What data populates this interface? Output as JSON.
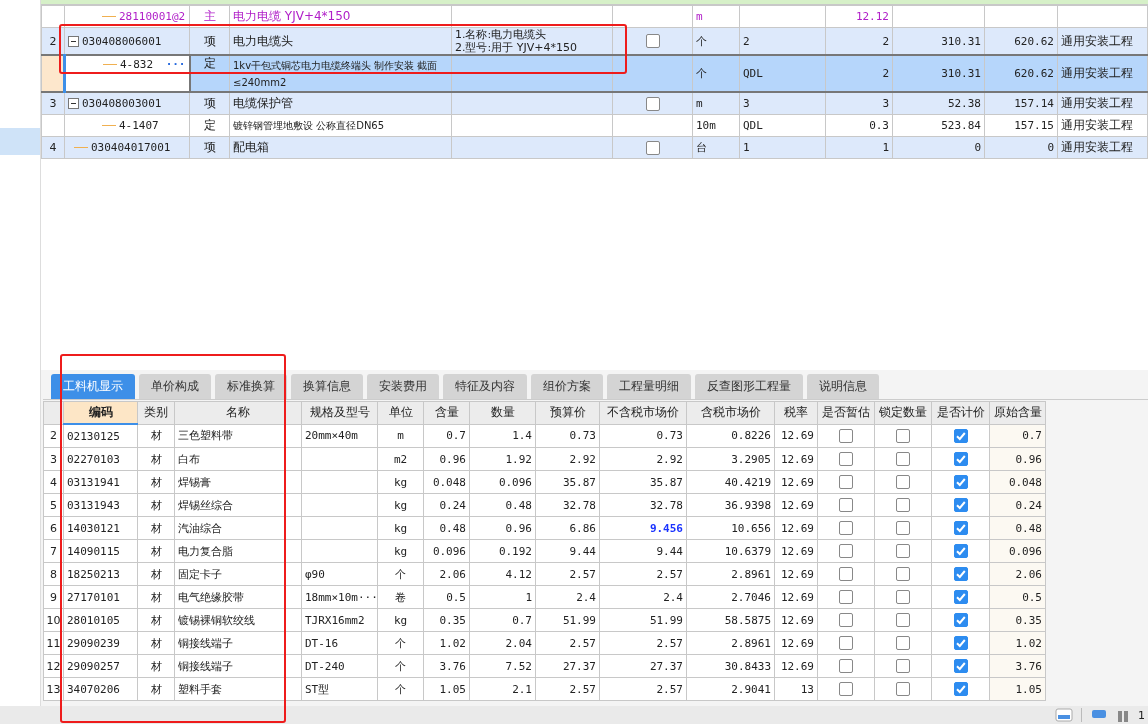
{
  "top_table": {
    "rows": [
      {
        "kind": "material",
        "selected": false,
        "code": "28110001@2",
        "type": "主",
        "name": "电力电缆 YJV+4*150",
        "unit": "m",
        "quantity": "12.12"
      },
      {
        "kind": "item",
        "selected": false,
        "num": "2",
        "expanded": true,
        "code": "030408006001",
        "type": "项",
        "name": "电力电缆头",
        "features": [
          "1.名称:电力电缆头",
          "2.型号:用于 YJV+4*150"
        ],
        "checked": false,
        "unit": "个",
        "qty_expr": "2",
        "quantity": "2",
        "price": "310.31",
        "total": "620.62",
        "category": "通用安装工程",
        "children": [
          {
            "kind": "quota",
            "selected": true,
            "code": "4-832",
            "edit_button": "···",
            "type": "定",
            "name": "1kv干包式铜芯电力电缆终端头 制作安装 截面≤240mm2",
            "unit": "个",
            "qty_expr": "QDL",
            "quantity": "2",
            "price": "310.31",
            "total": "620.62",
            "category": "通用安装工程"
          }
        ]
      },
      {
        "kind": "item",
        "selected": false,
        "num": "3",
        "expanded": true,
        "code": "030408003001",
        "type": "项",
        "name": "电缆保护管",
        "checked": false,
        "unit": "m",
        "qty_expr": "3",
        "quantity": "3",
        "price": "52.38",
        "total": "157.14",
        "category": "通用安装工程",
        "children": [
          {
            "kind": "quota",
            "selected": false,
            "code": "4-1407",
            "type": "定",
            "name": "镀锌钢管埋地敷设 公称直径DN65",
            "unit": "10m",
            "qty_expr": "QDL",
            "quantity": "0.3",
            "price": "523.84",
            "total": "157.15",
            "category": "通用安装工程"
          }
        ]
      },
      {
        "kind": "item",
        "selected": false,
        "num": "4",
        "code": "030404017001",
        "type": "项",
        "name": "配电箱",
        "checked": false,
        "unit": "台",
        "qty_expr": "1",
        "quantity": "1",
        "price": "0",
        "total": "0",
        "category": "通用安装工程"
      }
    ]
  },
  "tabs": [
    {
      "label": "工料机显示",
      "selected": true
    },
    {
      "label": "单价构成",
      "selected": false
    },
    {
      "label": "标准换算",
      "selected": false
    },
    {
      "label": "换算信息",
      "selected": false
    },
    {
      "label": "安装费用",
      "selected": false
    },
    {
      "label": "特征及内容",
      "selected": false
    },
    {
      "label": "组价方案",
      "selected": false
    },
    {
      "label": "工程量明细",
      "selected": false
    },
    {
      "label": "反查图形工程量",
      "selected": false
    },
    {
      "label": "说明信息",
      "selected": false
    }
  ],
  "resource_table": {
    "columns": [
      "编码",
      "类别",
      "名称",
      "规格及型号",
      "单位",
      "含量",
      "数量",
      "预算价",
      "不含税市场价",
      "含税市场价",
      "税率",
      "是否暂估",
      "锁定数量",
      "是否计价",
      "原始含量"
    ],
    "rows": [
      {
        "num": "2",
        "code": "02130125",
        "type": "材",
        "name": "三色塑料带",
        "spec": "20mm×40m",
        "unit": "m",
        "content": "0.7",
        "qty": "1.4",
        "budget": "0.73",
        "price_ex": "0.73",
        "modified": false,
        "price_in": "0.8226",
        "rate": "12.69",
        "estimated": false,
        "locked": false,
        "priced": true,
        "original": "0.7"
      },
      {
        "num": "3",
        "code": "02270103",
        "type": "材",
        "name": "白布",
        "unit": "m2",
        "content": "0.96",
        "qty": "1.92",
        "budget": "2.92",
        "price_ex": "2.92",
        "modified": false,
        "price_in": "3.2905",
        "rate": "12.69",
        "estimated": false,
        "locked": false,
        "priced": true,
        "original": "0.96"
      },
      {
        "num": "4",
        "code": "03131941",
        "type": "材",
        "name": "焊锡膏",
        "unit": "kg",
        "content": "0.048",
        "qty": "0.096",
        "budget": "35.87",
        "price_ex": "35.87",
        "modified": false,
        "price_in": "40.4219",
        "rate": "12.69",
        "estimated": false,
        "locked": false,
        "priced": true,
        "original": "0.048"
      },
      {
        "num": "5",
        "code": "03131943",
        "type": "材",
        "name": "焊锡丝综合",
        "unit": "kg",
        "content": "0.24",
        "qty": "0.48",
        "budget": "32.78",
        "price_ex": "32.78",
        "modified": false,
        "price_in": "36.9398",
        "rate": "12.69",
        "estimated": false,
        "locked": false,
        "priced": true,
        "original": "0.24"
      },
      {
        "num": "6",
        "code": "14030121",
        "type": "材",
        "name": "汽油综合",
        "unit": "kg",
        "content": "0.48",
        "qty": "0.96",
        "budget": "6.86",
        "price_ex": "9.456",
        "modified": true,
        "price_in": "10.656",
        "rate": "12.69",
        "estimated": false,
        "locked": false,
        "priced": true,
        "original": "0.48"
      },
      {
        "num": "7",
        "code": "14090115",
        "type": "材",
        "name": "电力复合脂",
        "unit": "kg",
        "content": "0.096",
        "qty": "0.192",
        "budget": "9.44",
        "price_ex": "9.44",
        "modified": false,
        "price_in": "10.6379",
        "rate": "12.69",
        "estimated": false,
        "locked": false,
        "priced": true,
        "original": "0.096"
      },
      {
        "num": "8",
        "code": "18250213",
        "type": "材",
        "name": "固定卡子",
        "spec": "φ90",
        "unit": "个",
        "content": "2.06",
        "qty": "4.12",
        "budget": "2.57",
        "price_ex": "2.57",
        "modified": false,
        "price_in": "2.8961",
        "rate": "12.69",
        "estimated": false,
        "locked": false,
        "priced": true,
        "original": "2.06"
      },
      {
        "num": "9",
        "code": "27170101",
        "type": "材",
        "name": "电气绝缘胶带",
        "spec": "18mm×10m···",
        "unit": "卷",
        "content": "0.5",
        "qty": "1",
        "budget": "2.4",
        "price_ex": "2.4",
        "modified": false,
        "price_in": "2.7046",
        "rate": "12.69",
        "estimated": false,
        "locked": false,
        "priced": true,
        "original": "0.5"
      },
      {
        "num": "10",
        "code": "28010105",
        "type": "材",
        "name": "镀锡裸铜软绞线",
        "spec": "TJRX16mm2",
        "unit": "kg",
        "content": "0.35",
        "qty": "0.7",
        "budget": "51.99",
        "price_ex": "51.99",
        "modified": false,
        "price_in": "58.5875",
        "rate": "12.69",
        "estimated": false,
        "locked": false,
        "priced": true,
        "original": "0.35"
      },
      {
        "num": "11",
        "code": "29090239",
        "type": "材",
        "name": "铜接线端子",
        "spec": "DT-16",
        "unit": "个",
        "content": "1.02",
        "qty": "2.04",
        "budget": "2.57",
        "price_ex": "2.57",
        "modified": false,
        "price_in": "2.8961",
        "rate": "12.69",
        "estimated": false,
        "locked": false,
        "priced": true,
        "original": "1.02"
      },
      {
        "num": "12",
        "code": "29090257",
        "type": "材",
        "name": "铜接线端子",
        "spec": "DT-240",
        "unit": "个",
        "content": "3.76",
        "qty": "7.52",
        "budget": "27.37",
        "price_ex": "27.37",
        "modified": false,
        "price_in": "30.8433",
        "rate": "12.69",
        "estimated": false,
        "locked": false,
        "priced": true,
        "original": "3.76"
      },
      {
        "num": "13",
        "code": "34070206",
        "type": "材",
        "name": "塑料手套",
        "spec": "ST型",
        "unit": "个",
        "content": "1.05",
        "qty": "2.1",
        "budget": "2.57",
        "price_ex": "2.57",
        "modified": false,
        "price_in": "2.9041",
        "rate": "13",
        "estimated": false,
        "locked": false,
        "priced": true,
        "original": "1.05"
      }
    ]
  },
  "status_bar": {
    "page": "1"
  }
}
